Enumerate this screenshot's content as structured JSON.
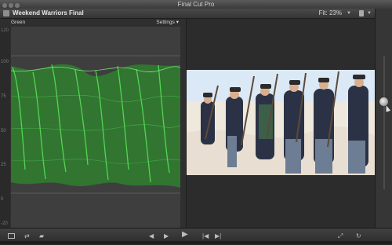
{
  "app": {
    "title": "Final Cut Pro"
  },
  "viewer_header": {
    "project_name": "Weekend Warriors Final",
    "fit_label": "Fit:",
    "zoom_value": "23%"
  },
  "scope": {
    "channel": "Green",
    "settings_label": "Settings",
    "scale_labels": [
      "120",
      "100",
      "75",
      "50",
      "25",
      "0",
      "-20"
    ],
    "waveform_color": "#3fd13f"
  },
  "video_frame": {
    "description_icon": "video-frame-icon"
  },
  "toolbar": {
    "icons": [
      "layout-icon",
      "view-options-icon",
      "range-icon",
      "jump-back-icon",
      "play-icon",
      "prev-edit-icon",
      "next-edit-icon",
      "fullscreen-icon",
      "loop-icon"
    ]
  },
  "colors": {
    "accent_green": "#3fd13f",
    "panel": "#2f2f2f",
    "plot": "#3e3e3e"
  }
}
